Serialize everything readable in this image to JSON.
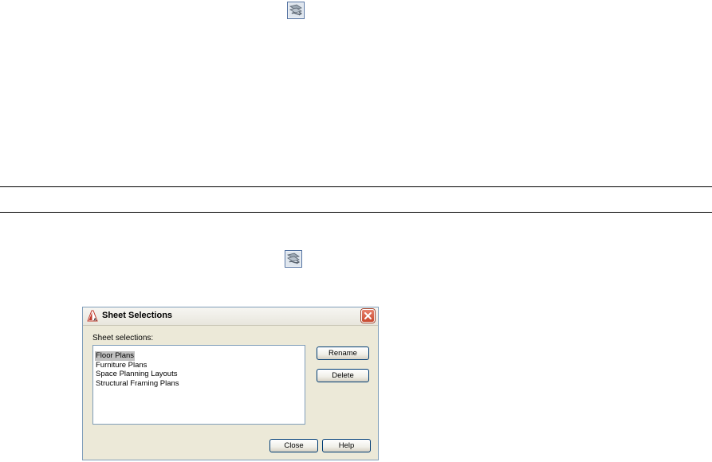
{
  "icons": {
    "top": "sheet-set-icon",
    "middle": "sheet-set-icon"
  },
  "dialog": {
    "title": "Sheet Selections",
    "list_label": "Sheet selections:",
    "items": [
      {
        "label": "Floor Plans",
        "selected": true
      },
      {
        "label": "Furniture Plans",
        "selected": false
      },
      {
        "label": "Space Planning Layouts",
        "selected": false
      },
      {
        "label": "Structural Framing Plans",
        "selected": false
      }
    ],
    "buttons": {
      "rename": "Rename",
      "delete": "Delete",
      "close": "Close",
      "help": "Help"
    }
  },
  "colors": {
    "dialog_bg": "#ece9d8",
    "button_border": "#003c74",
    "close_button": "#c8492e",
    "selection": "#c0c0c0"
  }
}
